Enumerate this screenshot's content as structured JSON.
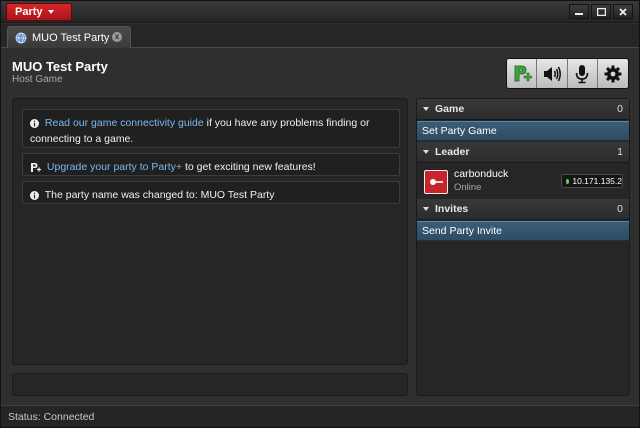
{
  "titlebar": {
    "party_menu_label": "Party",
    "buttons": [
      "minimize",
      "maximize",
      "close"
    ]
  },
  "tab": {
    "label": "MUO Test Party",
    "close_glyph": "x"
  },
  "header": {
    "title": "MUO Test Party",
    "subtitle": "Host Game",
    "toolbar": [
      "invite-player-icon",
      "speaker-icon",
      "microphone-icon",
      "gear-icon"
    ]
  },
  "messages": [
    {
      "icon": "info-icon",
      "link": "Read our game connectivity guide",
      "text": " if you have any problems finding or connecting to a game."
    },
    {
      "icon": "upgrade-icon",
      "link": "Upgrade your party to Party+",
      "text": " to get exciting new features!"
    },
    {
      "icon": "info-icon",
      "link": "",
      "text": "The party name was changed to: MUO Test Party"
    }
  ],
  "sidebar": {
    "game": {
      "label": "Game",
      "count": "0",
      "action": "Set Party Game"
    },
    "leader": {
      "label": "Leader",
      "count": "1",
      "member": {
        "name": "carbonduck",
        "status": "Online",
        "ip": "10.171.135.2"
      }
    },
    "invites": {
      "label": "Invites",
      "count": "0",
      "action": "Send Party Invite"
    }
  },
  "statusbar": {
    "text": "Status: Connected"
  },
  "colors": {
    "accent_red": "#c8242b",
    "link_blue": "#7ab8f0",
    "action_blue": "#3a5e78",
    "online_green": "#5fd05f"
  }
}
